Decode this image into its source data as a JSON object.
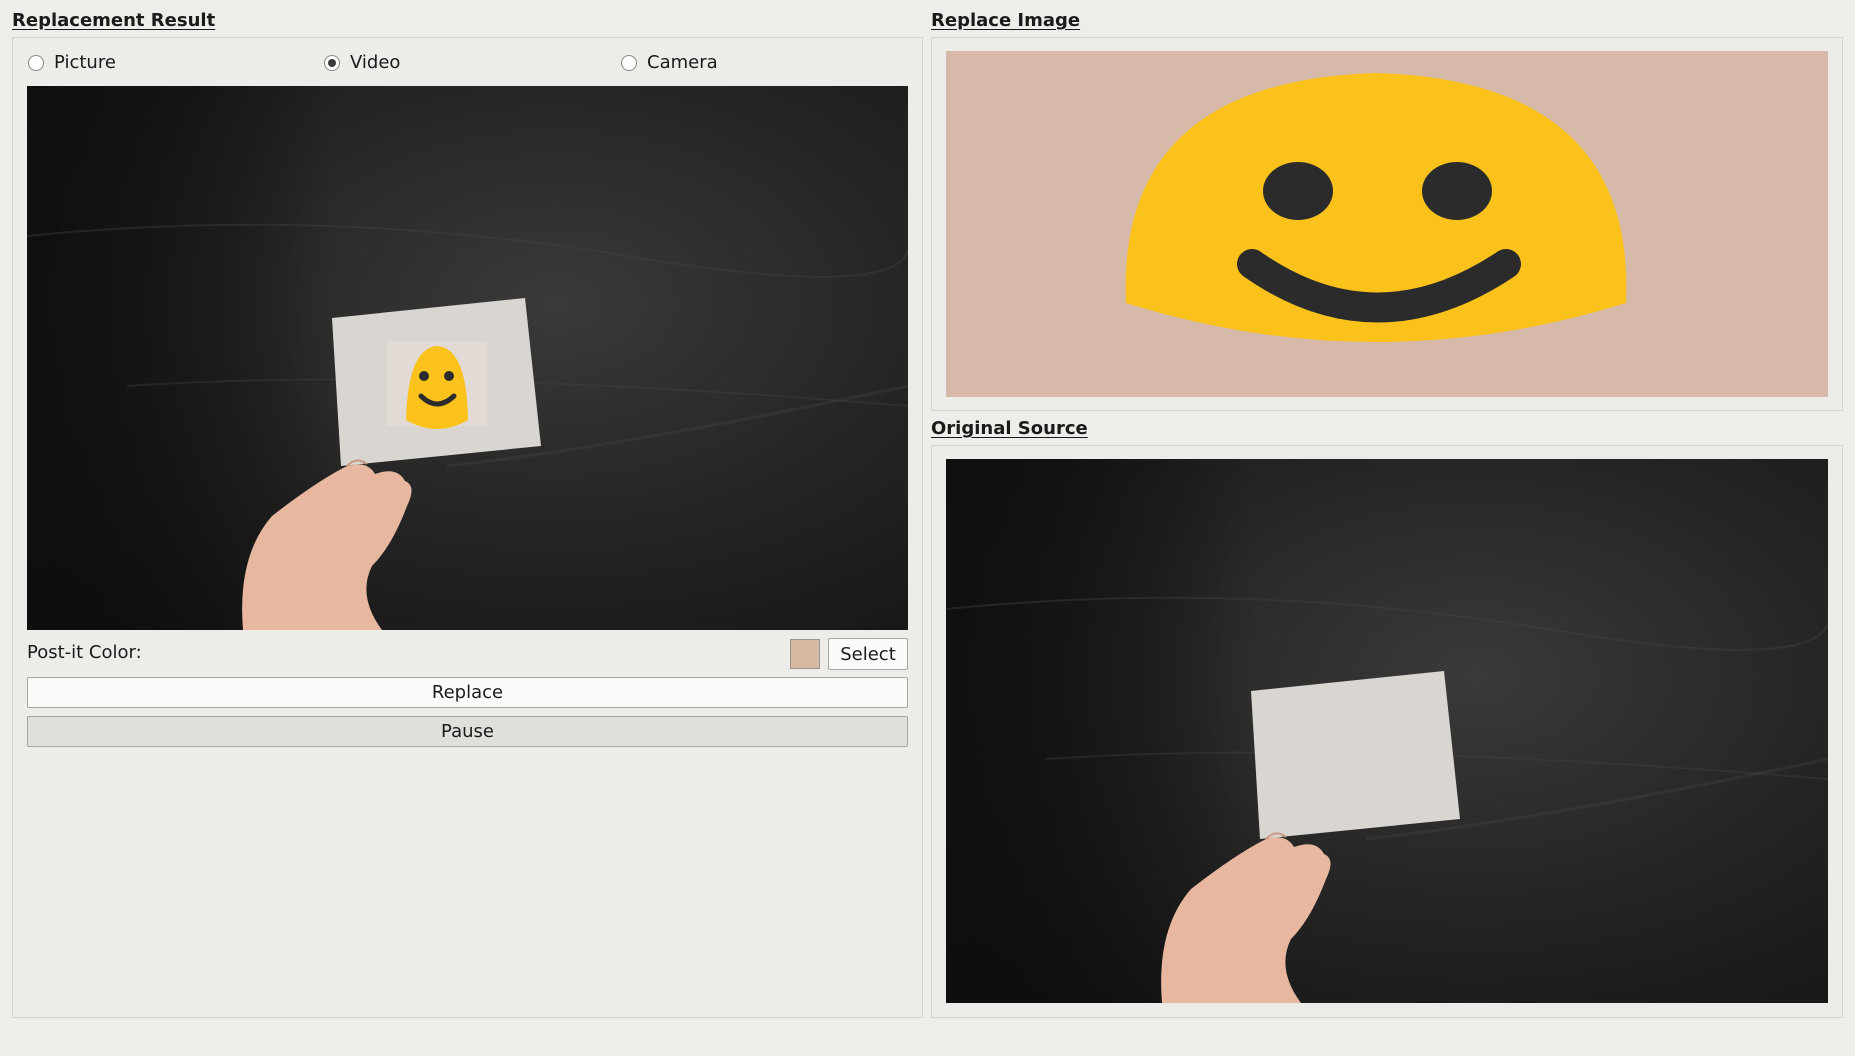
{
  "left_panel": {
    "title": "Replacement Result",
    "sources": [
      {
        "label": "Picture",
        "checked": false
      },
      {
        "label": "Video",
        "checked": true
      },
      {
        "label": "Camera",
        "checked": false
      }
    ],
    "color_label": "Post-it Color:",
    "color_value": "#d6b9a3",
    "select_label": "Select",
    "replace_label": "Replace",
    "pause_label": "Pause"
  },
  "right_top": {
    "title": "Replace Image"
  },
  "right_bottom": {
    "title": "Original Source"
  },
  "colors": {
    "window_bg": "#efede9",
    "emoji_yellow": "#fbc21c",
    "emoji_dark": "#2b2b2b",
    "replace_bg": "#d6b9a8"
  }
}
